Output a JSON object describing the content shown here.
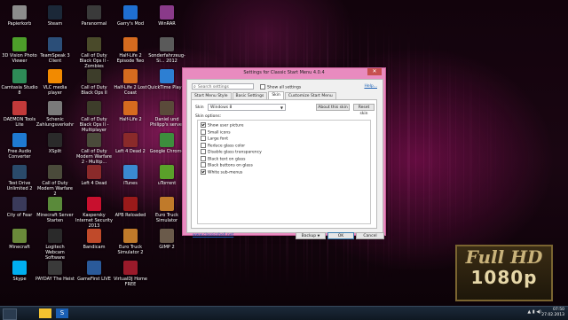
{
  "desktop_icons": [
    {
      "label": "Papierkorb",
      "color": "#8c8c8c"
    },
    {
      "label": "Steam",
      "color": "#1b2838"
    },
    {
      "label": "Paranormal",
      "color": "#3a3a3a"
    },
    {
      "label": "Garry's Mod",
      "color": "#1f6fd1"
    },
    {
      "label": "WinRAR",
      "color": "#8a3a8a"
    },
    {
      "label": "3D Vision Photo Viewer",
      "color": "#4d9e2a"
    },
    {
      "label": "TeamSpeak 3 Client",
      "color": "#2b4e78"
    },
    {
      "label": "Call of Duty Black Ops II - Zombies",
      "color": "#4a4a2a"
    },
    {
      "label": "Half-Life 2 Episode Two",
      "color": "#d66b1f"
    },
    {
      "label": "Sonderfahrzeug-Si... 2012",
      "color": "#5a5a5a"
    },
    {
      "label": "Camtasia Studio 8",
      "color": "#2e8b57"
    },
    {
      "label": "VLC media player",
      "color": "#f28a00"
    },
    {
      "label": "Call of Duty Black Ops II",
      "color": "#3d3d2a"
    },
    {
      "label": "Half-Life 2 Lost Coast",
      "color": "#d66b1f"
    },
    {
      "label": "QuickTime Player",
      "color": "#2d7fd3"
    },
    {
      "label": "DAEMON Tools Lite",
      "color": "#c23a3a"
    },
    {
      "label": "Schenic Zahlungsverkehr",
      "color": "#7a7a7a"
    },
    {
      "label": "Call of Duty Black Ops II - Multiplayer",
      "color": "#3d3d2a"
    },
    {
      "label": "Half-Life 2",
      "color": "#d66b1f"
    },
    {
      "label": "Daniel und Philipp's server",
      "color": "#5a4a3a"
    },
    {
      "label": "Free Audio Converter",
      "color": "#1f7ad1"
    },
    {
      "label": "XSplit",
      "color": "#2a2a2a"
    },
    {
      "label": "Call of Duty Modern Warfare 2 - Multip...",
      "color": "#4a4a3a"
    },
    {
      "label": "Left 4 Dead 2",
      "color": "#8a2a2a"
    },
    {
      "label": "Google Chrome",
      "color": "#3d8e3d"
    },
    {
      "label": "Test Drive Unlimited 2",
      "color": "#2a4a6a"
    },
    {
      "label": "Call of Duty Modern Warfare 2",
      "color": "#4a4a3a"
    },
    {
      "label": "Left 4 Dead",
      "color": "#8a2a2a"
    },
    {
      "label": "iTunes",
      "color": "#3a8ad1"
    },
    {
      "label": "uTorrent",
      "color": "#5aa02a"
    },
    {
      "label": "City of Fear",
      "color": "#3a3a5a"
    },
    {
      "label": "Minecraft Server Starten",
      "color": "#5a8a3a"
    },
    {
      "label": "Kaspersky Internet Security 2013",
      "color": "#c8102e"
    },
    {
      "label": "APB Reloaded",
      "color": "#9a1a1a"
    },
    {
      "label": "Euro Truck Simulator",
      "color": "#c07a2a"
    },
    {
      "label": "Minecraft",
      "color": "#6a8a3a"
    },
    {
      "label": "Logitech Webcam Software",
      "color": "#2a2a2a"
    },
    {
      "label": "Bandicam",
      "color": "#c04a2a"
    },
    {
      "label": "Euro Truck Simulator 2",
      "color": "#c07a2a"
    },
    {
      "label": "GIMP 2",
      "color": "#6a5a4a"
    },
    {
      "label": "Skype",
      "color": "#00aff0"
    },
    {
      "label": "PAYDAY The Heist",
      "color": "#3a3a3a"
    },
    {
      "label": "GameFirst LIVE",
      "color": "#2a5a9a"
    },
    {
      "label": "VirtualDJ Home FREE",
      "color": "#9a1a2a"
    }
  ],
  "window": {
    "title": "Settings for Classic Start Menu 4.0.4",
    "close": "✕",
    "search_placeholder": "Search settings",
    "show_all": "Show all settings",
    "help": "Help...",
    "tabs": [
      "Start Menu Style",
      "Basic Settings",
      "Skin",
      "Customize Start Menu"
    ],
    "active_tab": "Skin",
    "skin_label": "Skin",
    "skin_value": "Windows 8",
    "about_button": "About this skin",
    "reset_button": "Reset skin",
    "options_label": "Skin options:",
    "options": [
      {
        "label": "Show user picture",
        "checked": true
      },
      {
        "label": "Small icons",
        "checked": false
      },
      {
        "label": "Large font",
        "checked": false
      },
      {
        "label": "Reduce glass color",
        "checked": false
      },
      {
        "label": "Disable glass transparency",
        "checked": false
      },
      {
        "label": "Black text on glass",
        "checked": false
      },
      {
        "label": "Black buttons on glass",
        "checked": false
      },
      {
        "label": "White sub-menus",
        "checked": true
      }
    ],
    "link": "www.classicshell.net",
    "backup_button": "Backup",
    "ok_button": "OK",
    "cancel_button": "Cancel"
  },
  "badge": {
    "line1": "Full HD",
    "line2": "1080p"
  },
  "taskbar": {
    "time": "07:50",
    "date": "27.02.2013",
    "tray_icons": [
      "network-icon",
      "volume-icon",
      "flag-icon"
    ]
  },
  "colors": {
    "window_frame": "#e88bbf",
    "accent": "#1a5fb4",
    "close": "#c7504f"
  }
}
